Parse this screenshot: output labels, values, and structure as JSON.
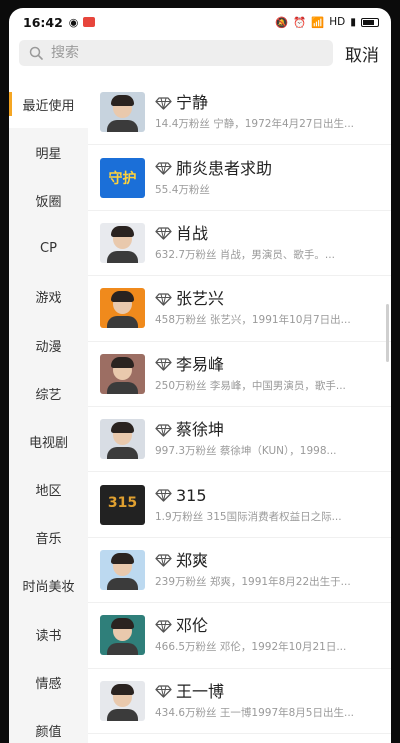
{
  "status": {
    "time": "16:42",
    "network": "HD"
  },
  "search": {
    "placeholder": "搜索",
    "cancel": "取消"
  },
  "categories": [
    "最近使用",
    "明星",
    "饭圈",
    "CP",
    "游戏",
    "动漫",
    "综艺",
    "电视剧",
    "地区",
    "音乐",
    "时尚美妆",
    "读书",
    "情感",
    "颜值"
  ],
  "active_category": "最近使用",
  "items": [
    {
      "name": "宁静",
      "desc": "14.4万粉丝 宁静，1972年4月27日出生...",
      "avatar_bg": "#c7d3de"
    },
    {
      "name": "肺炎患者求助",
      "desc": "55.4万粉丝",
      "avatar_bg": "#1b6fd8",
      "avatar_text": "守护"
    },
    {
      "name": "肖战",
      "desc": "632.7万粉丝 肖战，男演员、歌手。...",
      "avatar_bg": "#e8eaee"
    },
    {
      "name": "张艺兴",
      "desc": "458万粉丝 张艺兴，1991年10月7日出...",
      "avatar_bg": "#f08a1c"
    },
    {
      "name": "李易峰",
      "desc": "250万粉丝 李易峰，中国男演员，歌手...",
      "avatar_bg": "#9c6e63"
    },
    {
      "name": "蔡徐坤",
      "desc": "997.3万粉丝 蔡徐坤（KUN），1998...",
      "avatar_bg": "#d8dde4"
    },
    {
      "name": "315",
      "desc": "1.9万粉丝 315国际消费者权益日之际...",
      "avatar_bg": "#222222",
      "avatar_text": "315"
    },
    {
      "name": "郑爽",
      "desc": "239万粉丝 郑爽，1991年8月22出生于...",
      "avatar_bg": "#bcd9f0"
    },
    {
      "name": "邓伦",
      "desc": "466.5万粉丝 邓伦，1992年10月21日...",
      "avatar_bg": "#2f7f7a"
    },
    {
      "name": "王一博",
      "desc": "434.6万粉丝 王一博1997年8月5日出生...",
      "avatar_bg": "#e6e8ec"
    }
  ]
}
